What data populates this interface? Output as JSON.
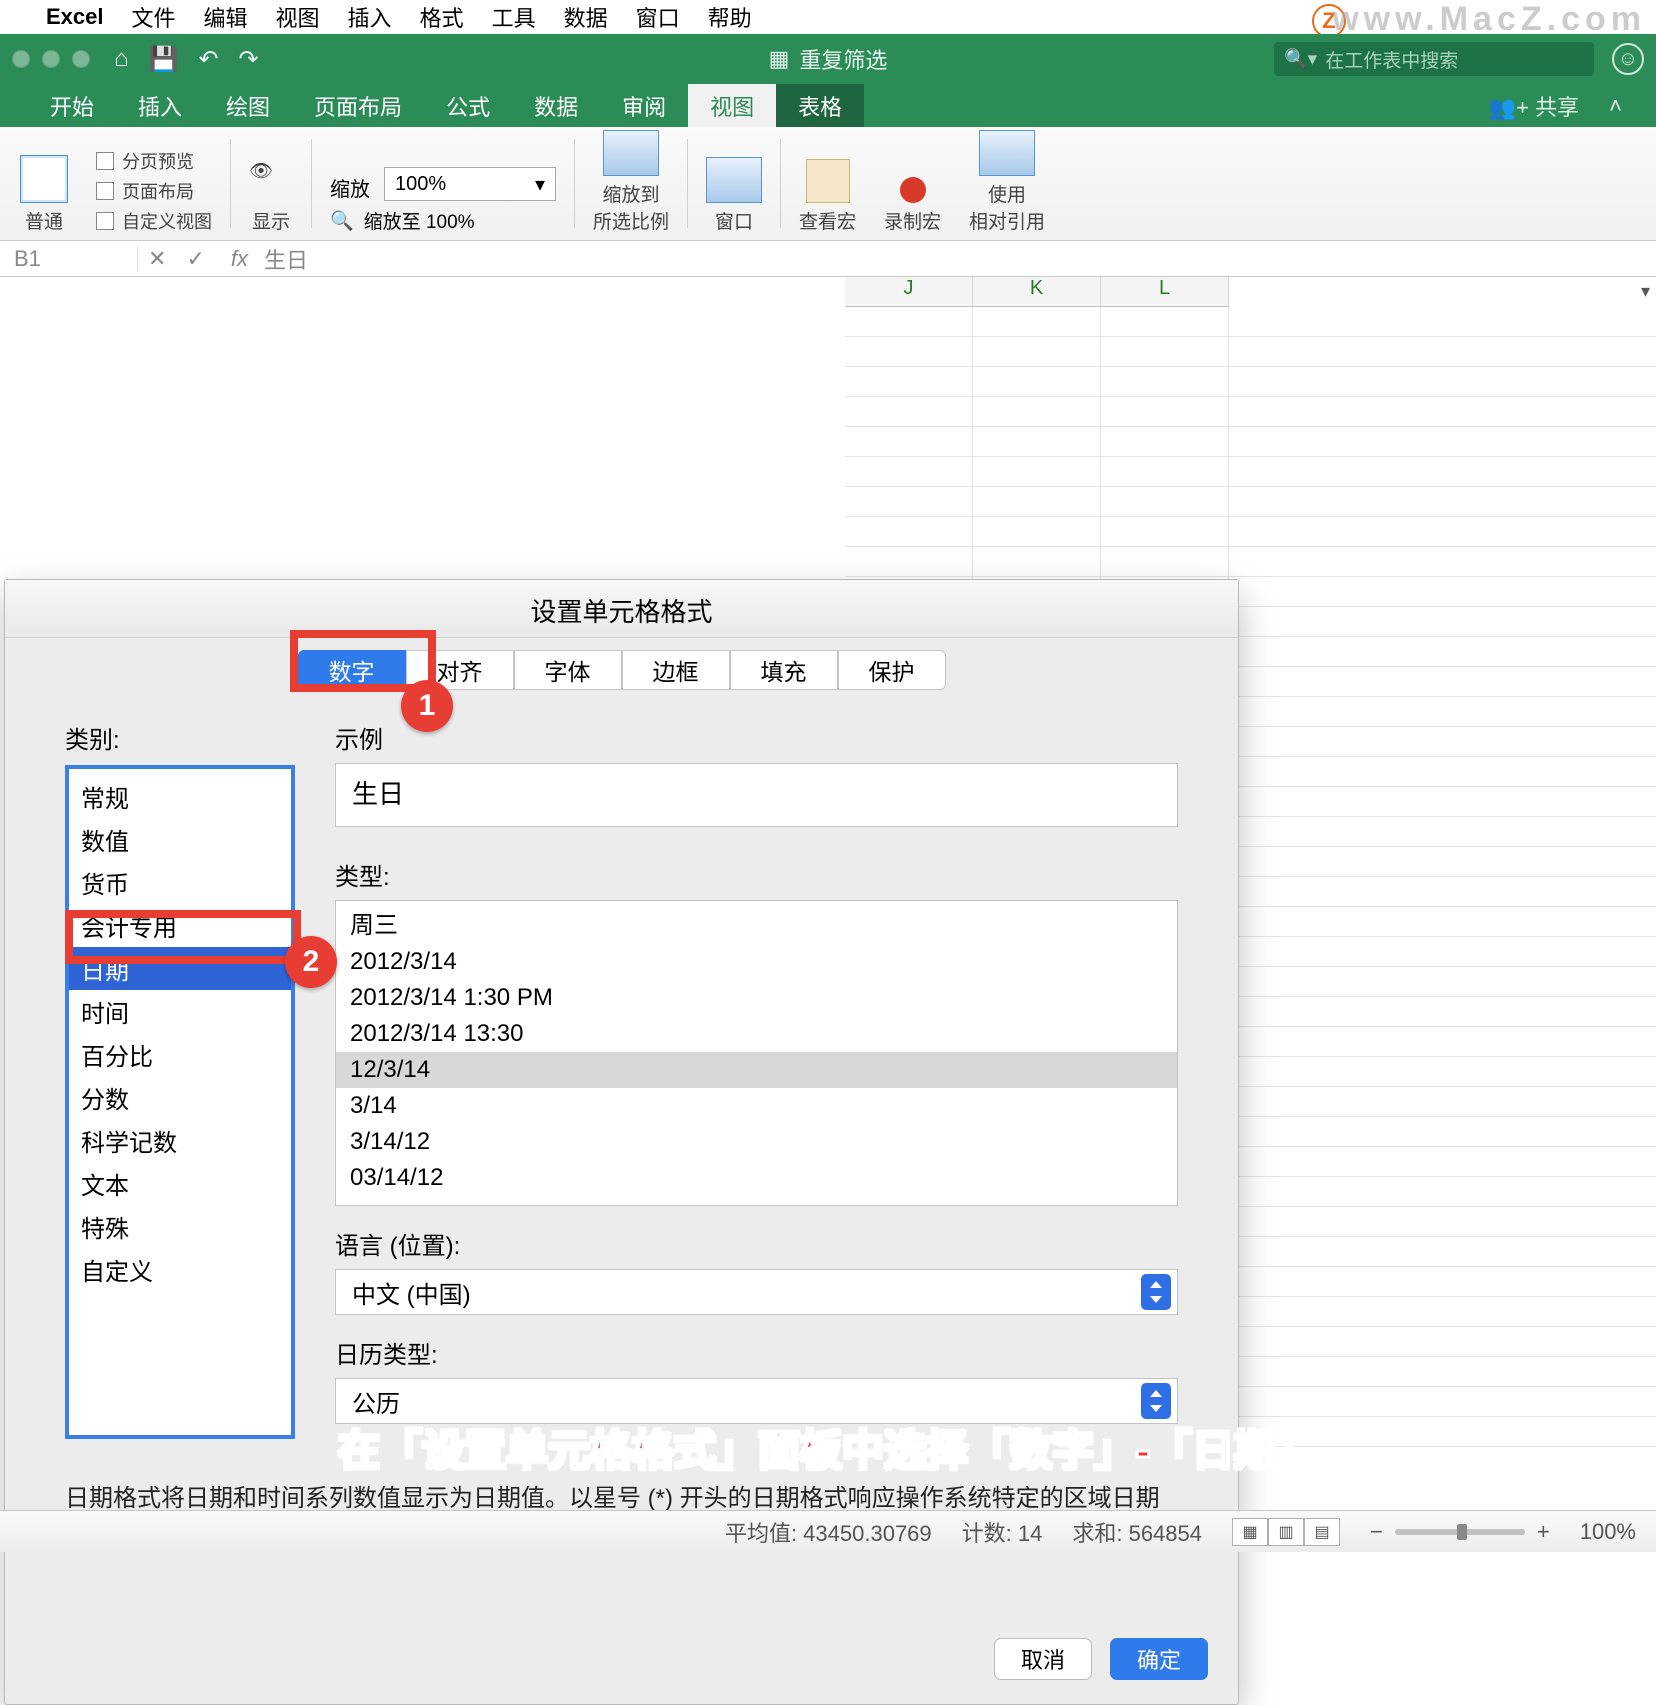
{
  "mac_menu": {
    "app": "Excel",
    "items": [
      "文件",
      "编辑",
      "视图",
      "插入",
      "格式",
      "工具",
      "数据",
      "窗口",
      "帮助"
    ]
  },
  "watermark": {
    "badge": "Z",
    "url": "www.MacZ.com"
  },
  "titlebar": {
    "doc": "重复筛选",
    "search_placeholder": "在工作表中搜索"
  },
  "ribbon_tabs": [
    "开始",
    "插入",
    "绘图",
    "页面布局",
    "公式",
    "数据",
    "审阅",
    "视图",
    "表格"
  ],
  "ribbon_tabs_active": "视图",
  "ribbon_right": {
    "share": "共享"
  },
  "ribbon": {
    "normal": "普通",
    "views": [
      "分页预览",
      "页面布局",
      "自定义视图"
    ],
    "show": "显示",
    "zoom_label": "缩放",
    "zoom_value": "100%",
    "zoom_to100": "缩放至 100%",
    "zoom_selection": "缩放到\n所选比例",
    "window": "窗口",
    "view_macro": "查看宏",
    "record_macro": "录制宏",
    "relative_ref": "使用\n相对引用"
  },
  "formula": {
    "cell": "B1",
    "value": "生日"
  },
  "columns": [
    "J",
    "K",
    "L"
  ],
  "dialog": {
    "title": "设置单元格格式",
    "tabs": [
      "数字",
      "对齐",
      "字体",
      "边框",
      "填充",
      "保护"
    ],
    "active_tab": "数字",
    "category_label": "类别:",
    "categories": [
      "常规",
      "数值",
      "货币",
      "会计专用",
      "日期",
      "时间",
      "百分比",
      "分数",
      "科学记数",
      "文本",
      "特殊",
      "自定义"
    ],
    "selected_category": "日期",
    "sample_label": "示例",
    "sample_value": "生日",
    "type_label": "类型:",
    "types": [
      "周三",
      "2012/3/14",
      "2012/3/14 1:30 PM",
      "2012/3/14 13:30",
      "12/3/14",
      "3/14",
      "3/14/12",
      "03/14/12"
    ],
    "selected_type": "12/3/14",
    "locale_label": "语言 (位置):",
    "locale_value": "中文 (中国)",
    "calendar_label": "日历类型:",
    "calendar_value": "公历",
    "description": "日期格式将日期和时间系列数值显示为日期值。以星号 (*) 开头的日期格式响应操作系统特定的区域日期和时间设置的更改。不带星号的格式不受操作系统设置的影响。",
    "cancel": "取消",
    "ok": "确定"
  },
  "annot_badges": {
    "b1": "1",
    "b2": "2"
  },
  "annotation": "在「设置单元格格式」面板中选择「数字」-「日期」",
  "status": {
    "avg": "平均值: 43450.30769",
    "count": "计数: 14",
    "sum": "求和: 564854",
    "zoom": "100%"
  }
}
